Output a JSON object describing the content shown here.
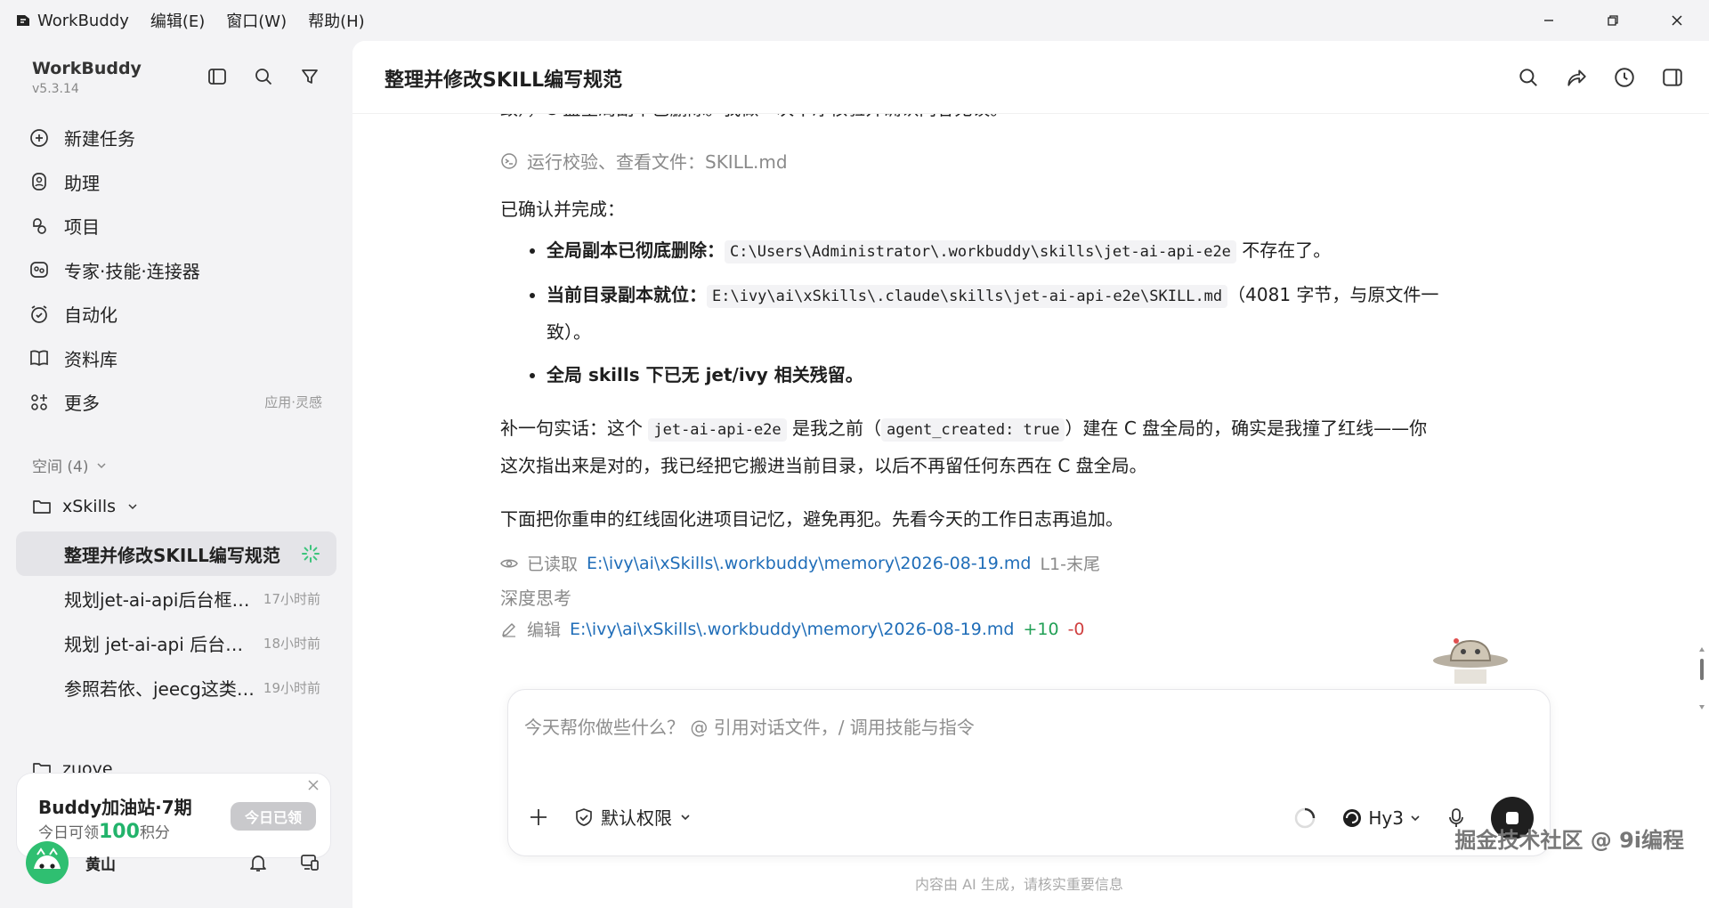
{
  "titlebar": {
    "app": "WorkBuddy",
    "menus": [
      "编辑(E)",
      "窗口(W)",
      "帮助(H)"
    ]
  },
  "sidebar": {
    "app_name": "WorkBuddy",
    "version": "v5.3.14",
    "nav": [
      {
        "label": "新建任务",
        "icon": "new-task-icon"
      },
      {
        "label": "助理",
        "icon": "assistant-icon"
      },
      {
        "label": "项目",
        "icon": "project-icon"
      },
      {
        "label": "专家·技能·连接器",
        "icon": "expert-icon"
      },
      {
        "label": "自动化",
        "icon": "automation-icon"
      },
      {
        "label": "资料库",
        "icon": "library-icon"
      },
      {
        "label": "更多",
        "icon": "more-icon",
        "extra": "应用·灵感"
      }
    ],
    "space_header": "空间 (4)",
    "folder": "xSkills",
    "tasks": [
      {
        "title": "整理并修改SKILL编写规范",
        "time": ""
      },
      {
        "title": "规划jet-ai-api后台框架与模块设计",
        "time": "17小时前"
      },
      {
        "title": "规划 jet-ai-api 后台管理系统",
        "time": "18小时前"
      },
      {
        "title": "参照若依、jeecg这类框架",
        "time": "19小时前"
      }
    ],
    "folder2": "zuoye",
    "promo": {
      "title": "Buddy加油站·7期",
      "sub_prefix": "今日可领",
      "points": "100",
      "sub_suffix": "积分",
      "button": "今日已领"
    },
    "user": {
      "name": "黄山"
    }
  },
  "main": {
    "title": "整理并修改SKILL编写规范",
    "cut_line": "致），C 盘全局副本已删除。我做一次干净核验并确认内容无误。",
    "tool_line": "运行校验、查看文件：SKILL.md",
    "confirm": "已确认并完成：",
    "bullets": [
      {
        "bold": "全局副本已彻底删除：",
        "code": "C:\\Users\\Administrator\\.workbuddy\\skills\\jet-ai-api-e2e",
        "text": " 不存在了。"
      },
      {
        "bold": "当前目录副本就位：",
        "code": "E:\\ivy\\ai\\xSkills\\.claude\\skills\\jet-ai-api-e2e\\SKILL.md",
        "text": "（4081 字节，与原文件一致）。"
      },
      {
        "bold": "全局 skills 下已无 jet/ivy 相关残留。",
        "code": "",
        "text": ""
      }
    ],
    "p1_a": "补一句实话：这个 ",
    "p1_code1": "jet-ai-api-e2e",
    "p1_b": " 是我之前（",
    "p1_code2": "agent_created: true",
    "p1_c": "）建在 C 盘全局的，确实是我撞了红线——你这次指出来是对的，我已经把它搬进当前目录，以后不再留任何东西在 C 盘全局。",
    "p2": "下面把你重申的红线固化进项目记忆，避免再犯。先看今天的工作日志再追加。",
    "read_op": {
      "label": "已读取",
      "path": "E:\\ivy\\ai\\xSkills\\.workbuddy\\memory\\2026-08-19.md",
      "range": "L1-末尾"
    },
    "thinking": "深度思考",
    "edit_op": {
      "label": "编辑",
      "path": "E:\\ivy\\ai\\xSkills\\.workbuddy\\memory\\2026-08-19.md",
      "plus": "+10",
      "minus": "-0"
    }
  },
  "composer": {
    "placeholder": "今天帮你做些什么？ @ 引用对话文件，/ 调用技能与指令",
    "permission": "默认权限",
    "model": "Hy3"
  },
  "disclaimer": "内容由 AI 生成，请核实重要信息",
  "watermark": "掘金技术社区 @ 9i编程"
}
